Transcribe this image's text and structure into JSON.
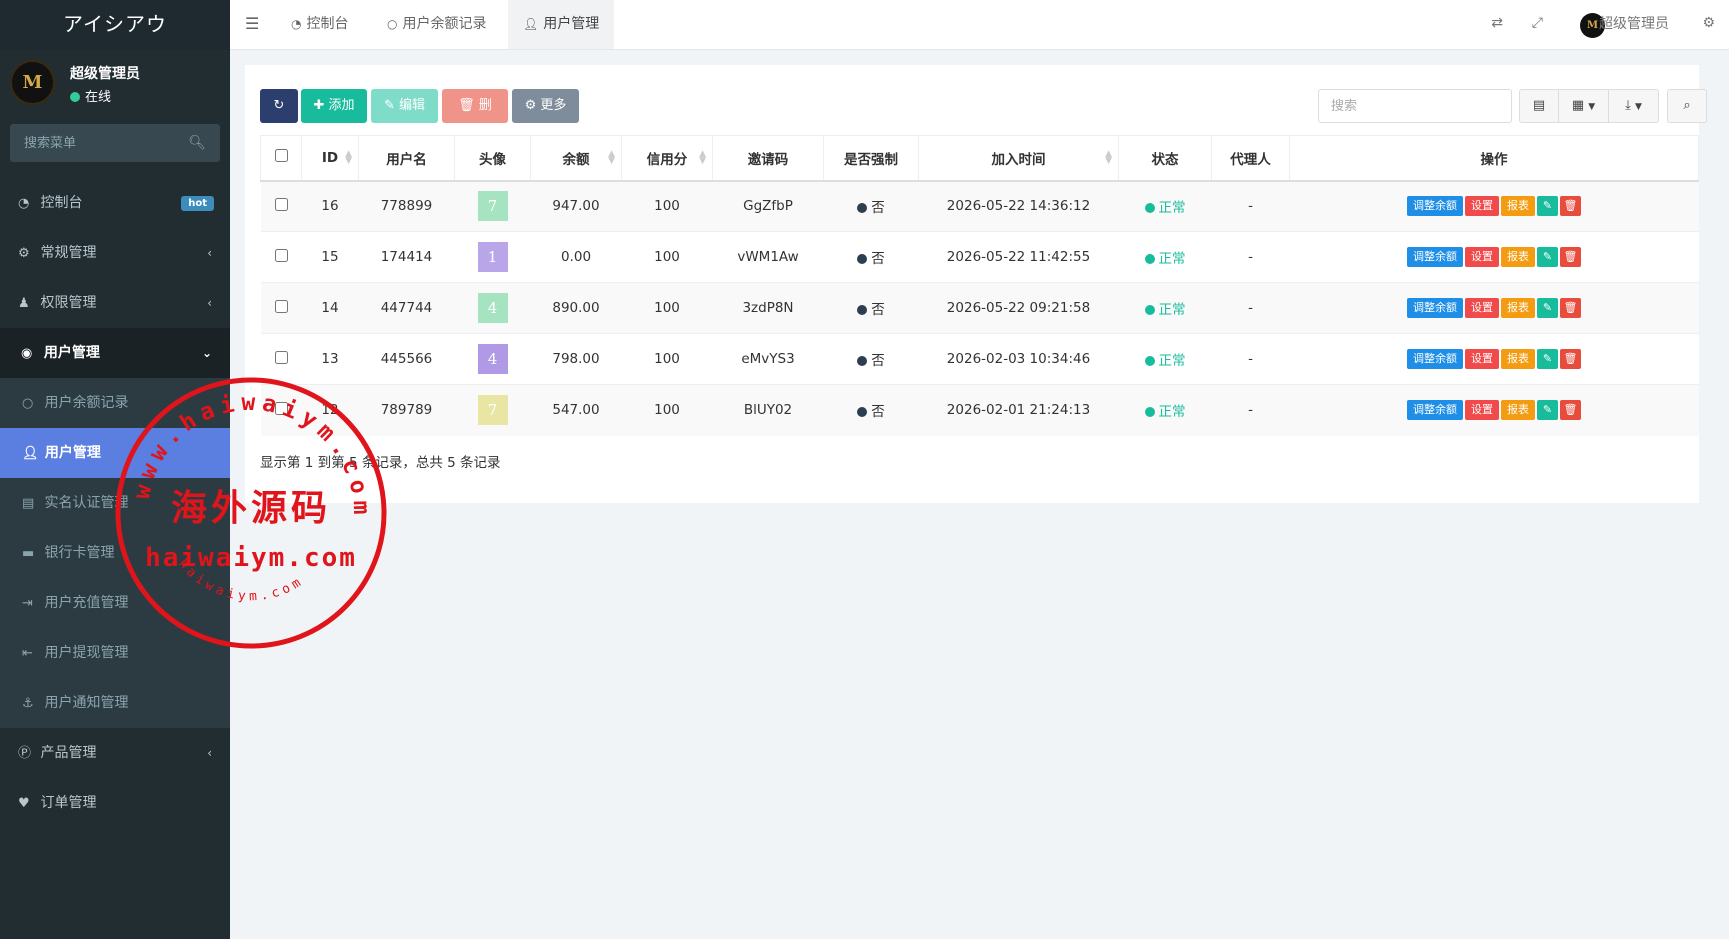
{
  "sidebar": {
    "brand": "アイシアウ",
    "user_name": "超级管理员",
    "user_status": "在线",
    "avatar_text": "M",
    "search_placeholder": "搜索菜单",
    "items": [
      {
        "label": "控制台",
        "icon": "dashboard-icon",
        "badge": "hot"
      },
      {
        "label": "常规管理",
        "icon": "cogs-icon"
      },
      {
        "label": "权限管理",
        "icon": "group-icon"
      },
      {
        "label": "用户管理",
        "icon": "user-circle-icon"
      },
      {
        "label": "产品管理",
        "icon": "product-icon"
      },
      {
        "label": "订单管理",
        "icon": "heartbeat-icon"
      }
    ],
    "sub_items": [
      {
        "label": "用户余额记录",
        "icon": "circle-icon"
      },
      {
        "label": "用户管理",
        "icon": "user-icon"
      },
      {
        "label": "实名认证管理",
        "icon": "id-card-icon"
      },
      {
        "label": "银行卡管理",
        "icon": "credit-card-icon"
      },
      {
        "label": "用户充值管理",
        "icon": "sign-in-icon"
      },
      {
        "label": "用户提现管理",
        "icon": "sign-out-icon"
      },
      {
        "label": "用户通知管理",
        "icon": "anchor-icon"
      }
    ]
  },
  "header": {
    "tabs": [
      {
        "label": "控制台",
        "icon": "dashboard-icon"
      },
      {
        "label": "用户余额记录",
        "icon": "circle-icon"
      },
      {
        "label": "用户管理",
        "icon": "user-icon"
      }
    ],
    "user_name": "超级管理员",
    "avatar_text": "M"
  },
  "toolbar": {
    "add": "添加",
    "edit": "编辑",
    "delete": "删除",
    "more": "更多",
    "search_placeholder": "搜索"
  },
  "table": {
    "headers": [
      "ID",
      "用户名",
      "头像",
      "余额",
      "信用分",
      "邀请码",
      "是否强制",
      "加入时间",
      "状态",
      "代理人",
      "操作"
    ],
    "rows": [
      {
        "id": "16",
        "username": "778899",
        "avatar_digit": "7",
        "avatar_color": "#a6e3c0",
        "balance": "947.00",
        "credit": "100",
        "invite": "GgZfbP",
        "force": "否",
        "joined": "2026-05-22 14:36:12",
        "status": "正常",
        "agent": "-"
      },
      {
        "id": "15",
        "username": "174414",
        "avatar_digit": "1",
        "avatar_color": "#b9a6e8",
        "balance": "0.00",
        "credit": "100",
        "invite": "vWM1Aw",
        "force": "否",
        "joined": "2026-05-22 11:42:55",
        "status": "正常",
        "agent": "-"
      },
      {
        "id": "14",
        "username": "447744",
        "avatar_digit": "4",
        "avatar_color": "#a6e3c0",
        "balance": "890.00",
        "credit": "100",
        "invite": "3zdP8N",
        "force": "否",
        "joined": "2026-05-22 09:21:58",
        "status": "正常",
        "agent": "-"
      },
      {
        "id": "13",
        "username": "445566",
        "avatar_digit": "4",
        "avatar_color": "#b09ae6",
        "balance": "798.00",
        "credit": "100",
        "invite": "eMvYS3",
        "force": "否",
        "joined": "2026-02-03 10:34:46",
        "status": "正常",
        "agent": "-"
      },
      {
        "id": "12",
        "username": "789789",
        "avatar_digit": "7",
        "avatar_color": "#e8e6a2",
        "balance": "547.00",
        "credit": "100",
        "invite": "BlUY02",
        "force": "否",
        "joined": "2026-02-01 21:24:13",
        "status": "正常",
        "agent": "-"
      }
    ],
    "actions": {
      "adjust": "调整余额",
      "settings": "设置",
      "report": "报表"
    }
  },
  "pager_text": "显示第 1 到第 5 条记录，总共 5 条记录",
  "watermark": {
    "url": "haiwaiym.com",
    "cn": "海外源码",
    "ring": "www.haiwaiym.com"
  }
}
